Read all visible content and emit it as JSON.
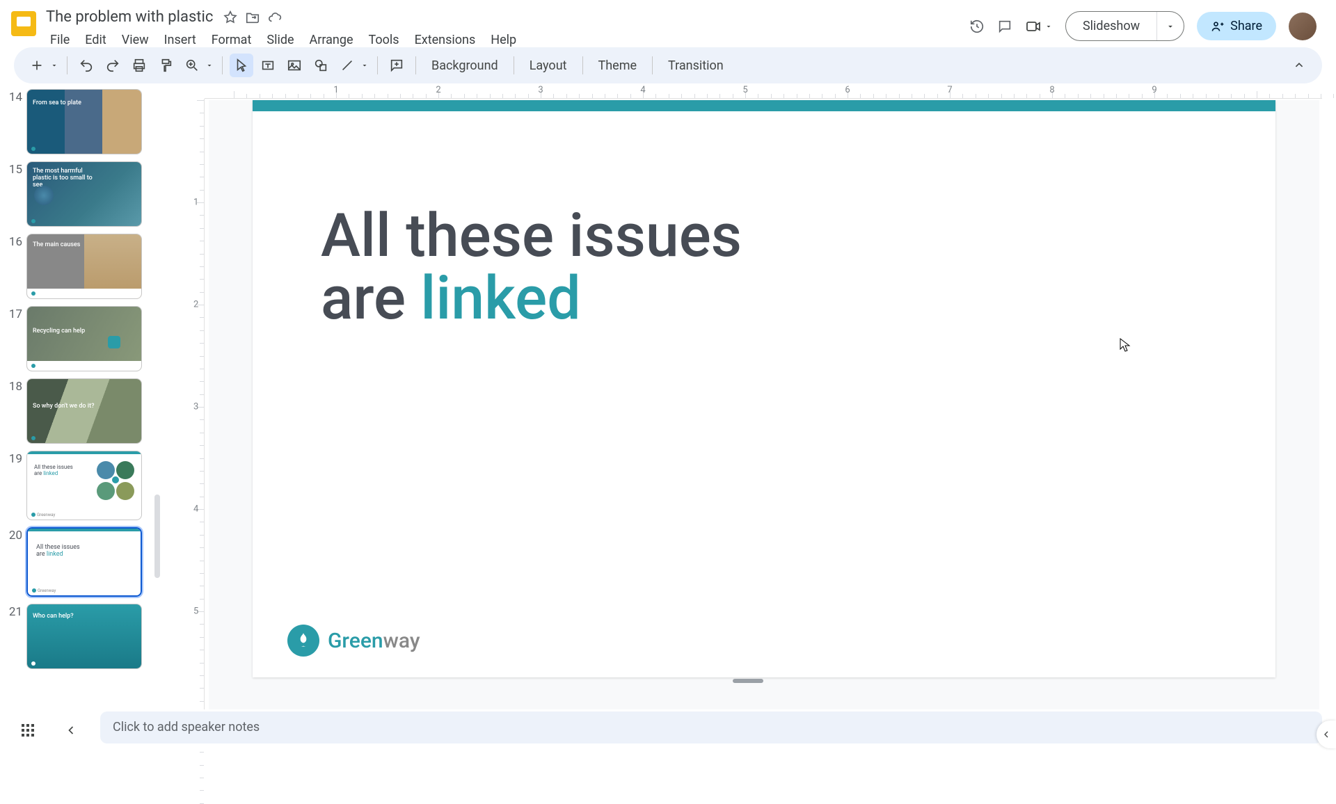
{
  "doc": {
    "title": "The problem with plastic"
  },
  "menu": [
    "File",
    "Edit",
    "View",
    "Insert",
    "Format",
    "Slide",
    "Arrange",
    "Tools",
    "Extensions",
    "Help"
  ],
  "header": {
    "slideshow": "Slideshow",
    "share": "Share"
  },
  "toolbar": {
    "background": "Background",
    "layout": "Layout",
    "theme": "Theme",
    "transition": "Transition"
  },
  "ruler_h": [
    "1",
    "2",
    "3",
    "4",
    "5",
    "6",
    "7",
    "8",
    "9"
  ],
  "ruler_v": [
    "1",
    "2",
    "3",
    "4",
    "5"
  ],
  "filmstrip": [
    {
      "num": "14",
      "caption": "From sea to plate",
      "style": "img-ocean"
    },
    {
      "num": "15",
      "caption": "The most harmful plastic is too small to see",
      "style": "img-turtle"
    },
    {
      "num": "16",
      "caption": "The main causes",
      "style": "img-beach"
    },
    {
      "num": "17",
      "caption": "Recycling can help",
      "style": "img-hand"
    },
    {
      "num": "18",
      "caption": "So why don't we do it?",
      "style": "img-trash"
    },
    {
      "num": "19",
      "caption": "All these issues are linked",
      "style": "white-circles"
    },
    {
      "num": "20",
      "caption": "All these issues are linked",
      "style": "white-plain",
      "active": true
    },
    {
      "num": "21",
      "caption": "Who can help?",
      "style": "teal-crowd"
    }
  ],
  "slide": {
    "heading_line1": "All these issues",
    "heading_line2_pre": "are ",
    "heading_line2_em": "linked",
    "logo_part1": "Green",
    "logo_part2": "way"
  },
  "notes": {
    "placeholder": "Click to add speaker notes"
  }
}
